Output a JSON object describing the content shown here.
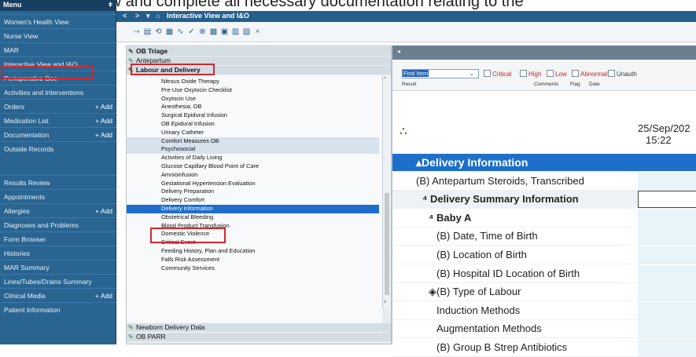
{
  "instruction_text": "Navigate to iView and complete all necessary documentation relating to the",
  "nav": {
    "header": "Menu",
    "pin": "ǂ",
    "items": [
      {
        "label": "Women's Health View",
        "add": ""
      },
      {
        "label": "Nurse View",
        "add": ""
      },
      {
        "label": "MAR",
        "add": ""
      },
      {
        "label": "Interactive View and I&O",
        "add": ""
      },
      {
        "label": "Perioperative Doc",
        "add": ""
      },
      {
        "label": "Activities and Interventions",
        "add": ""
      },
      {
        "label": "Orders",
        "add": "+ Add"
      },
      {
        "label": "Medication List",
        "add": "+ Add"
      },
      {
        "label": "Documentation",
        "add": "+ Add"
      },
      {
        "label": "Outside Records",
        "add": ""
      },
      {
        "label": "Results Review",
        "add": ""
      },
      {
        "label": "Appointments",
        "add": ""
      },
      {
        "label": "Allergies",
        "add": "+ Add"
      },
      {
        "label": "Diagnoses and Problems",
        "add": ""
      },
      {
        "label": "Form Browser",
        "add": ""
      },
      {
        "label": "Histories",
        "add": ""
      },
      {
        "label": "MAR Summary",
        "add": ""
      },
      {
        "label": "Lines/Tubes/Drains Summary",
        "add": ""
      },
      {
        "label": "Clinical Media",
        "add": "+ Add"
      },
      {
        "label": "Patient Information",
        "add": ""
      }
    ]
  },
  "topbar": {
    "title": "Interactive View and I&O",
    "back": "<",
    "forward": ">",
    "dropdown": "▾",
    "home": "⌂"
  },
  "bands": {
    "top": [
      {
        "label": "OB Triage"
      },
      {
        "label": "Antepartum"
      },
      {
        "label": "Labour and Delivery"
      }
    ],
    "sections": [
      "Nitrous Oxide Therapy",
      "Pre-Use Oxytocin Checklist",
      "Oxytocin Use",
      "Anesthesia, OB",
      "Surgical Epidural Infusion",
      "OB Epidural Infusion",
      "Urinary Catheter",
      "Comfort Measures OB",
      "Psychosocial",
      "Activities of Daily Living",
      "Glucose Capillary Blood Point of Care",
      "Amnioinfusion",
      "Gestational Hypertension Evaluation",
      "Delivery Preparation",
      "Delivery Comfort",
      "Delivery Information",
      "Obstetrical Bleeding",
      "Blood Product Transfusion",
      "Domestic Violence",
      "Critical Event",
      "Feeding History, Plan and Education",
      "Falls Risk Assessment",
      "Community Services"
    ],
    "bottom": [
      {
        "label": "Newborn Delivery Data"
      },
      {
        "label": "OB PARR"
      }
    ]
  },
  "filter": {
    "find": "Find Item",
    "checks": [
      "Critical",
      "High",
      "Low",
      "Abnormal",
      "Unauth"
    ],
    "columns": [
      "Result",
      "Comments",
      "Flag",
      "Date"
    ]
  },
  "flowsheet": {
    "date": "25/Sep/202",
    "time": "15:22",
    "rows": [
      {
        "label": "Delivery Information",
        "type": "header",
        "prefix": "▴"
      },
      {
        "label": "(B) Antepartum Steroids, Transcribed",
        "type": "item",
        "prefix": ""
      },
      {
        "label": "Delivery Summary Information",
        "type": "sub",
        "prefix": "⁴ "
      },
      {
        "label": "Baby A",
        "type": "subsub",
        "prefix": "⁴ "
      },
      {
        "label": "(B) Date, Time of Birth",
        "type": "item",
        "prefix": ""
      },
      {
        "label": "(B) Location of Birth",
        "type": "item",
        "prefix": ""
      },
      {
        "label": "(B) Hospital ID Location of Birth",
        "type": "item",
        "prefix": ""
      },
      {
        "label": "(B) Type of Labour",
        "type": "item",
        "prefix": "◈"
      },
      {
        "label": "Induction Methods",
        "type": "item",
        "prefix": ""
      },
      {
        "label": "Augmentation Methods",
        "type": "item",
        "prefix": ""
      },
      {
        "label": "(B) Group B Strep Antibiotics",
        "type": "item",
        "prefix": ""
      }
    ]
  },
  "colors": {
    "nav_bg": "#2a6592",
    "selection": "#1e6fc9",
    "highlight_box": "#d6262a"
  }
}
